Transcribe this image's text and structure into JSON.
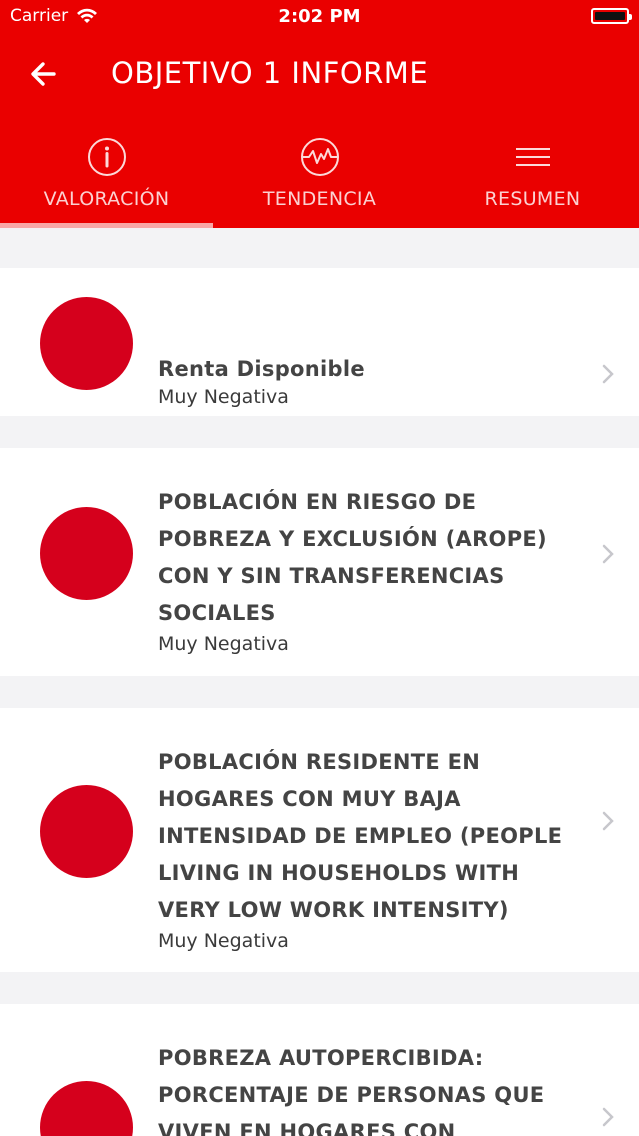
{
  "status_bar": {
    "carrier": "Carrier",
    "time": "2:02 PM"
  },
  "header": {
    "title": "OBJETIVO 1 INFORME",
    "back_icon": "arrow-left-icon"
  },
  "tabs": [
    {
      "label": "VALORACIÓN",
      "icon": "info-circle-icon",
      "selected": true
    },
    {
      "label": "TENDENCIA",
      "icon": "trend-circle-icon",
      "selected": false
    },
    {
      "label": "RESUMEN",
      "icon": "menu-lines-icon",
      "selected": false
    }
  ],
  "colors": {
    "header": "#ea0000",
    "indicator_dot": "#d5001c",
    "background": "#f3f3f5"
  },
  "items": [
    {
      "name": "Renta Disponible",
      "status": "Muy Negativa"
    },
    {
      "name": "POBLACIÓN EN RIESGO DE POBREZA Y EXCLUSIÓN (AROPE) CON Y SIN TRANSFERENCIAS SOCIALES",
      "status": "Muy Negativa"
    },
    {
      "name": "POBLACIÓN RESIDENTE EN HOGARES CON MUY BAJA INTENSIDAD DE EMPLEO (PEOPLE LIVING IN HOUSEHOLDS WITH VERY LOW WORK INTENSITY)",
      "status": "Muy Negativa"
    },
    {
      "name": "POBREZA AUTOPERCIBIDA: PORCENTAJE DE PERSONAS QUE VIVEN EN HOGARES CON",
      "status": ""
    }
  ]
}
